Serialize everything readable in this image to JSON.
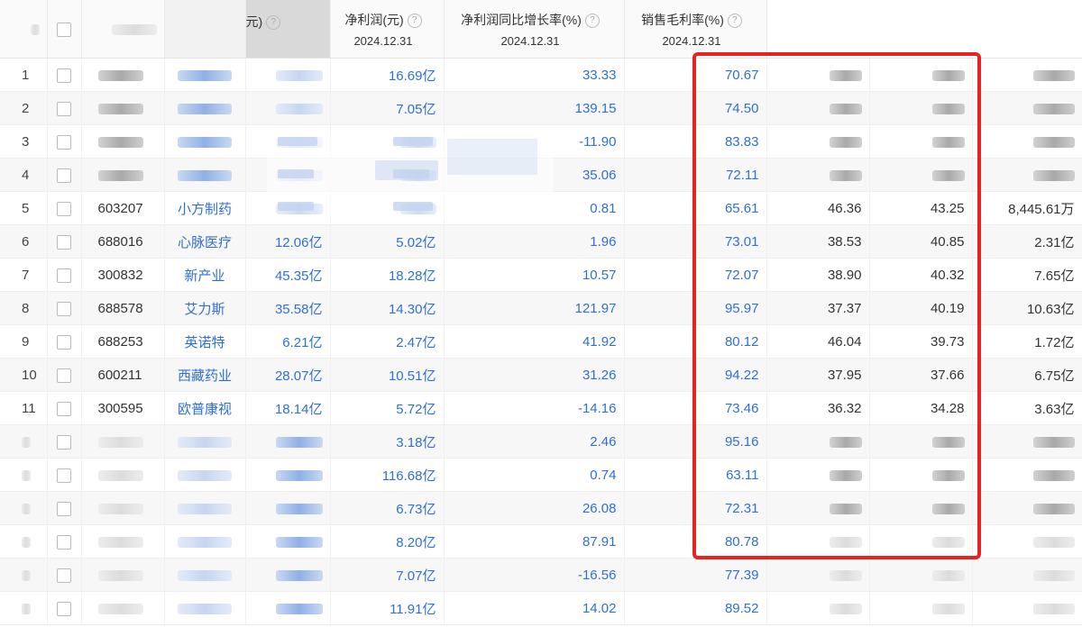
{
  "header": {
    "partial_col_title": "元)",
    "net_profit": {
      "title": "净利润(元)",
      "date": "2024.12.31"
    },
    "net_profit_growth": {
      "title": "净利润同比增长率(%)",
      "date": "2024.12.31"
    },
    "gross_margin": {
      "title": "销售毛利率(%)",
      "date": "2024.12.31"
    },
    "help_glyph": "?"
  },
  "rows": [
    {
      "idx": "1",
      "code": "",
      "name": "",
      "revenue": "",
      "net_profit": "16.69亿",
      "growth": "33.33",
      "margin": "70.67",
      "c1": "",
      "c2": "",
      "c3": ""
    },
    {
      "idx": "2",
      "code": "",
      "name": "",
      "revenue": "",
      "net_profit": "7.05亿",
      "growth": "139.15",
      "margin": "74.50",
      "c1": "",
      "c2": "",
      "c3": ""
    },
    {
      "idx": "3",
      "code": "",
      "name": "",
      "revenue": "",
      "net_profit": "",
      "growth": "-11.90",
      "margin": "83.83",
      "c1": "",
      "c2": "",
      "c3": ""
    },
    {
      "idx": "4",
      "code": "",
      "name": "",
      "revenue": "",
      "net_profit": "",
      "growth": "35.06",
      "margin": "72.11",
      "c1": "",
      "c2": "",
      "c3": ""
    },
    {
      "idx": "5",
      "code": "603207",
      "name": "小方制药",
      "revenue": "",
      "net_profit": "",
      "growth": "0.81",
      "margin": "65.61",
      "c1": "46.36",
      "c2": "43.25",
      "c3": "8,445.61万"
    },
    {
      "idx": "6",
      "code": "688016",
      "name": "心脉医疗",
      "revenue": "12.06亿",
      "net_profit": "5.02亿",
      "growth": "1.96",
      "margin": "73.01",
      "c1": "38.53",
      "c2": "40.85",
      "c3": "2.31亿"
    },
    {
      "idx": "7",
      "code": "300832",
      "name": "新产业",
      "revenue": "45.35亿",
      "net_profit": "18.28亿",
      "growth": "10.57",
      "margin": "72.07",
      "c1": "38.90",
      "c2": "40.32",
      "c3": "7.65亿"
    },
    {
      "idx": "8",
      "code": "688578",
      "name": "艾力斯",
      "revenue": "35.58亿",
      "net_profit": "14.30亿",
      "growth": "121.97",
      "margin": "95.97",
      "c1": "37.37",
      "c2": "40.19",
      "c3": "10.63亿"
    },
    {
      "idx": "9",
      "code": "688253",
      "name": "英诺特",
      "revenue": "6.21亿",
      "net_profit": "2.47亿",
      "growth": "41.92",
      "margin": "80.12",
      "c1": "46.04",
      "c2": "39.73",
      "c3": "1.72亿"
    },
    {
      "idx": "10",
      "code": "600211",
      "name": "西藏药业",
      "revenue": "28.07亿",
      "net_profit": "10.51亿",
      "growth": "31.26",
      "margin": "94.22",
      "c1": "37.95",
      "c2": "37.66",
      "c3": "6.75亿"
    },
    {
      "idx": "11",
      "code": "300595",
      "name": "欧普康视",
      "revenue": "18.14亿",
      "net_profit": "5.72亿",
      "growth": "-14.16",
      "margin": "73.46",
      "c1": "36.32",
      "c2": "34.28",
      "c3": "3.63亿"
    },
    {
      "idx": "",
      "code": "",
      "name": "",
      "revenue": "",
      "net_profit": "3.18亿",
      "growth": "2.46",
      "margin": "95.16",
      "c1": "",
      "c2": "",
      "c3": ""
    },
    {
      "idx": "",
      "code": "",
      "name": "",
      "revenue": "",
      "net_profit": "116.68亿",
      "growth": "0.74",
      "margin": "63.11",
      "c1": "",
      "c2": "",
      "c3": ""
    },
    {
      "idx": "",
      "code": "",
      "name": "",
      "revenue": "",
      "net_profit": "6.73亿",
      "growth": "26.08",
      "margin": "72.31",
      "c1": "",
      "c2": "",
      "c3": ""
    },
    {
      "idx": "",
      "code": "",
      "name": "",
      "revenue": "",
      "net_profit": "8.20亿",
      "growth": "87.91",
      "margin": "80.78",
      "c1": "",
      "c2": "",
      "c3": ""
    },
    {
      "idx": "",
      "code": "",
      "name": "",
      "revenue": "",
      "net_profit": "7.07亿",
      "growth": "-16.56",
      "margin": "77.39",
      "c1": "",
      "c2": "",
      "c3": ""
    },
    {
      "idx": "",
      "code": "",
      "name": "",
      "revenue": "",
      "net_profit": "11.91亿",
      "growth": "14.02",
      "margin": "89.52",
      "c1": "",
      "c2": "",
      "c3": ""
    }
  ],
  "colors": {
    "link_blue": "#2f6fd6",
    "highlight_red": "#e8231f"
  }
}
